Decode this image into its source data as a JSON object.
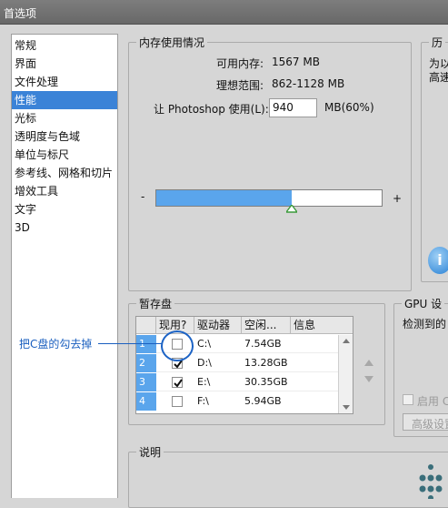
{
  "window": {
    "title": "首选项"
  },
  "nav": {
    "items": [
      "常规",
      "界面",
      "文件处理",
      "性能",
      "光标",
      "透明度与色域",
      "单位与标尺",
      "参考线、网格和切片",
      "增效工具",
      "文字",
      "3D"
    ],
    "active_index": 3
  },
  "memory": {
    "legend": "内存使用情况",
    "available_label": "可用内存:",
    "available_value": "1567 MB",
    "ideal_label": "理想范围:",
    "ideal_value": "862-1128 MB",
    "let_label": "让 Photoshop 使用(L):",
    "input_value": "940",
    "percent_text": "MB(60%)",
    "minus": "-",
    "plus": "+",
    "usage_fraction": 0.6
  },
  "history": {
    "legend": "历",
    "text1": "为以",
    "text2": "高速"
  },
  "scratch": {
    "legend": "暂存盘",
    "columns": [
      "现用?",
      "驱动器",
      "空闲...",
      "信息"
    ],
    "rows": [
      {
        "num": "1",
        "checked": false,
        "drive": "C:\\",
        "space": "7.54GB"
      },
      {
        "num": "2",
        "checked": true,
        "drive": "D:\\",
        "space": "13.28GB"
      },
      {
        "num": "3",
        "checked": true,
        "drive": "E:\\",
        "space": "30.35GB"
      },
      {
        "num": "4",
        "checked": false,
        "drive": "F:\\",
        "space": "5.94GB"
      }
    ]
  },
  "gpu": {
    "legend": "GPU 设",
    "detected": "检测到的",
    "enable_label": "启用 C",
    "advanced_button": "高级设置"
  },
  "description": {
    "legend": "说明"
  },
  "annotation": {
    "text": "把C盘的勾去掉"
  },
  "colors": {
    "accent": "#5aa5ec",
    "selection": "#3b83d7",
    "annotation": "#1a5fbf"
  }
}
